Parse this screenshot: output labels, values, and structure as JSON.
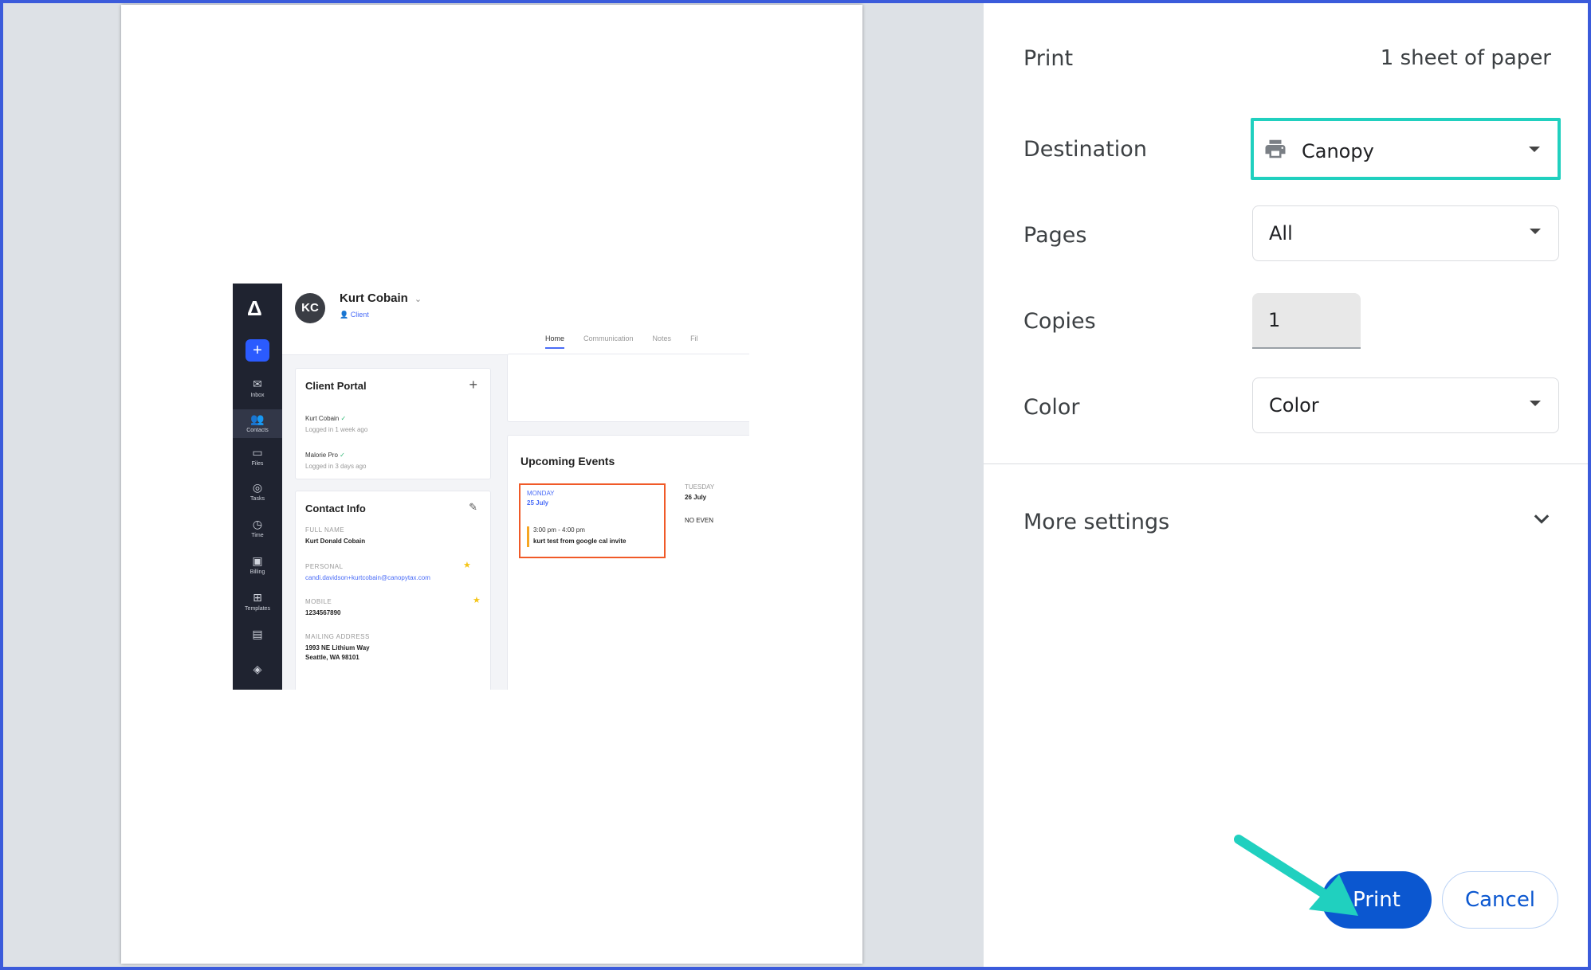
{
  "preview": {
    "client_name": "Kurt Cobain",
    "client_initials": "KC",
    "client_type": "Client",
    "tabs": [
      "Home",
      "Communication",
      "Notes",
      "Fil"
    ],
    "nav": {
      "inbox": "Inbox",
      "contacts": "Contacts",
      "files": "Files",
      "tasks": "Tasks",
      "time": "Time",
      "billing": "Billing",
      "templates": "Templates"
    },
    "client_portal": {
      "title": "Client Portal",
      "user1_name": "Kurt Cobain",
      "user1_status": "Logged in 1 week ago",
      "user2_name": "Malorie Pro",
      "user2_status": "Logged in 3 days ago"
    },
    "contact_info": {
      "title": "Contact Info",
      "full_name_label": "FULL NAME",
      "full_name": "Kurt Donald Cobain",
      "personal_label": "PERSONAL",
      "email": "candi.davidson+kurtcobain@canopytax.com",
      "mobile_label": "MOBILE",
      "mobile": "1234567890",
      "mailing_label": "MAILING ADDRESS",
      "address_line1": "1993 NE Lithium Way",
      "address_line2": "Seattle, WA 98101"
    },
    "events": {
      "title": "Upcoming Events",
      "day1": "MONDAY",
      "date1": "25 July",
      "time1": "3:00 pm - 4:00 pm",
      "event1": "kurt test from google cal invite",
      "day2": "TUESDAY",
      "date2": "26 July",
      "no_events": "NO EVEN"
    }
  },
  "print_panel": {
    "title": "Print",
    "sheet_count": "1 sheet of paper",
    "destination_label": "Destination",
    "destination_value": "Canopy",
    "pages_label": "Pages",
    "pages_value": "All",
    "copies_label": "Copies",
    "copies_value": "1",
    "color_label": "Color",
    "color_value": "Color",
    "more_settings": "More settings",
    "print_button": "Print",
    "cancel_button": "Cancel"
  },
  "colors": {
    "frame_border": "#3b5bdb",
    "highlight": "#20d0bf",
    "primary": "#0b57d0",
    "event_highlight": "#f05a28"
  },
  "icons": [
    "printer-icon",
    "caret-down-icon",
    "chevron-down-icon",
    "annotation-arrow-icon"
  ]
}
